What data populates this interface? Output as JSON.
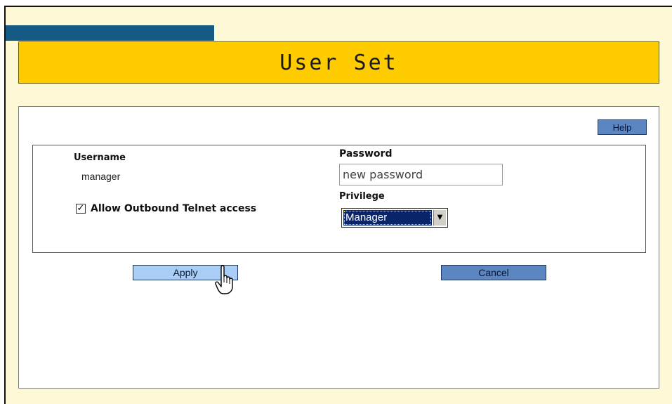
{
  "header": {
    "title": "User Set"
  },
  "toolbar": {
    "help_label": "Help"
  },
  "form": {
    "username_label": "Username",
    "username_value": "manager",
    "password_label": "Password",
    "password_value": "new password",
    "privilege_label": "Privilege",
    "privilege_value": "Manager",
    "telnet_label": "Allow Outbound Telnet access",
    "telnet_checked": true
  },
  "actions": {
    "apply_label": "Apply",
    "cancel_label": "Cancel"
  },
  "colors": {
    "title_bar": "#ffcc00",
    "tab": "#145a85",
    "button": "#5b86c2",
    "button_active": "#a9cdf5",
    "background": "#fdf8d6"
  }
}
